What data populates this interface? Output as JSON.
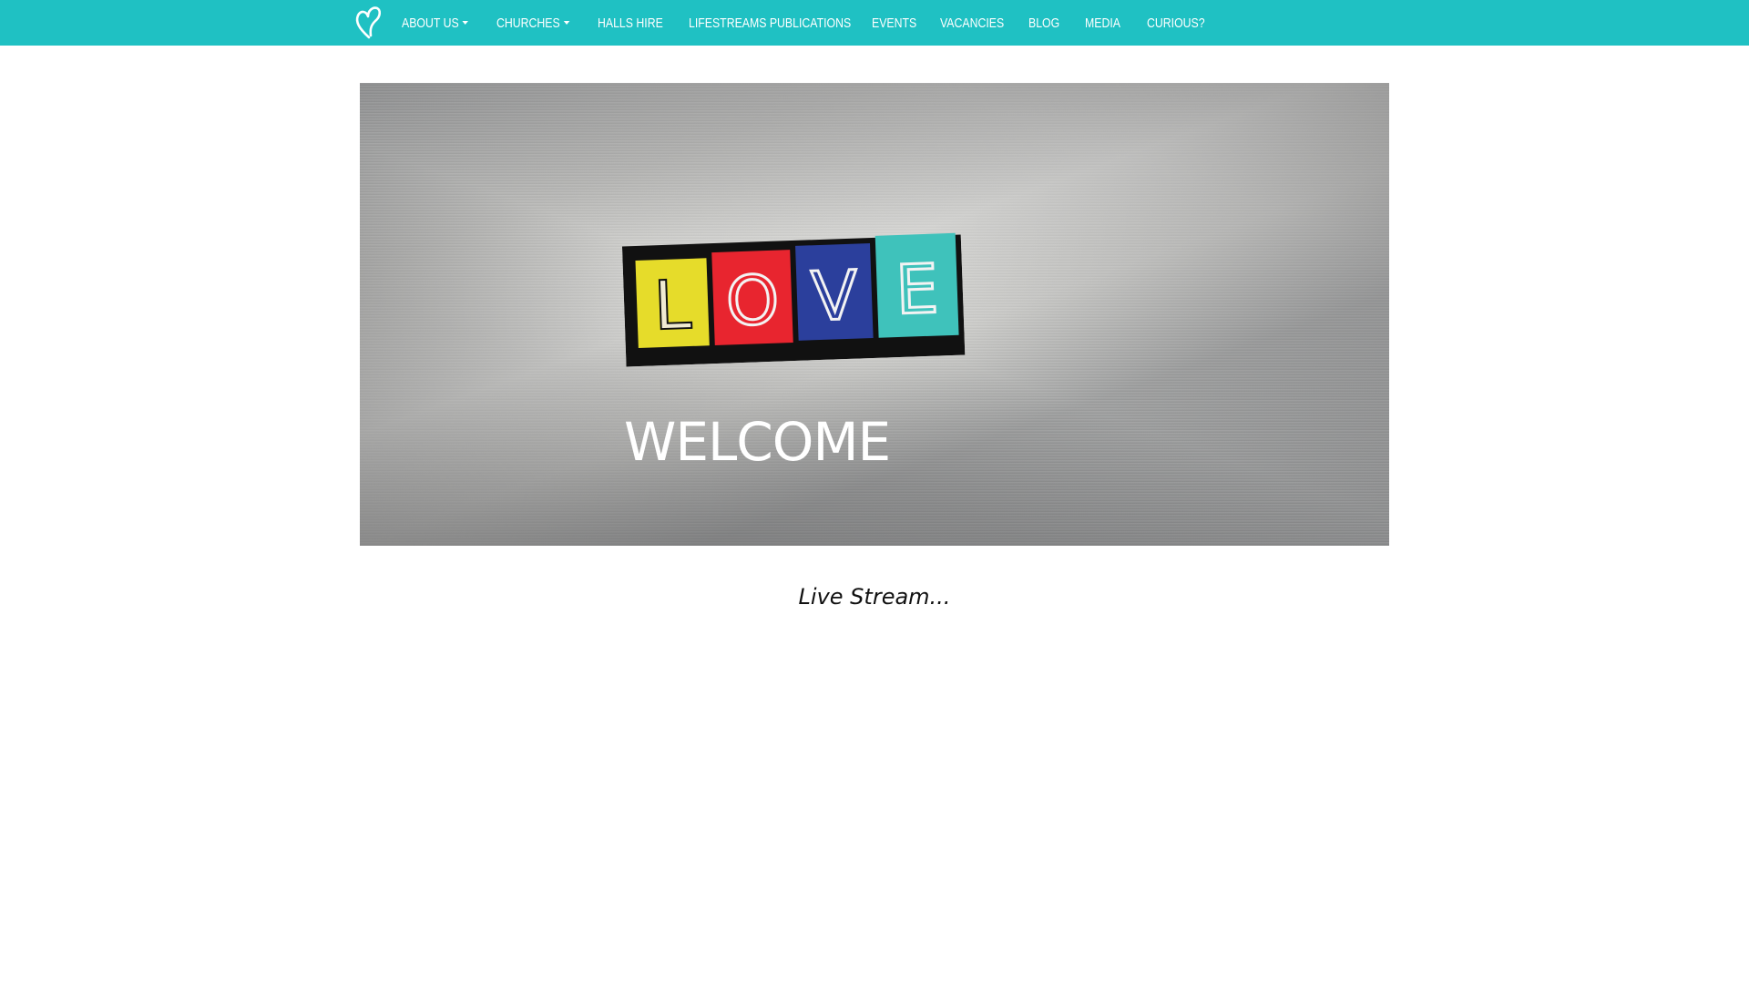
{
  "navbar": {
    "brand_icon": "heart-logo-icon",
    "colors": {
      "background": "#1fc1c3",
      "text": "#ffffff"
    },
    "items": [
      {
        "label": "ABOUT US",
        "dropdown": true
      },
      {
        "label": "CHURCHES",
        "dropdown": true
      },
      {
        "label": "HALLS HIRE",
        "dropdown": false
      },
      {
        "label": "LIFESTREAMS PUBLICATIONS",
        "dropdown": false
      },
      {
        "label": "EVENTS",
        "dropdown": false
      },
      {
        "label": "VACANCIES",
        "dropdown": false
      },
      {
        "label": "BLOG",
        "dropdown": false
      },
      {
        "label": "MEDIA",
        "dropdown": false
      },
      {
        "label": "CURIOUS?",
        "dropdown": false
      }
    ]
  },
  "hero": {
    "love_letters": [
      "L",
      "O",
      "V",
      "E"
    ],
    "love_colors": [
      "#e6dc2a",
      "#e8252f",
      "#2b3f9c",
      "#3fc2bb"
    ],
    "welcome": "WELCOME"
  },
  "main": {
    "live_stream": "Live Stream..."
  }
}
